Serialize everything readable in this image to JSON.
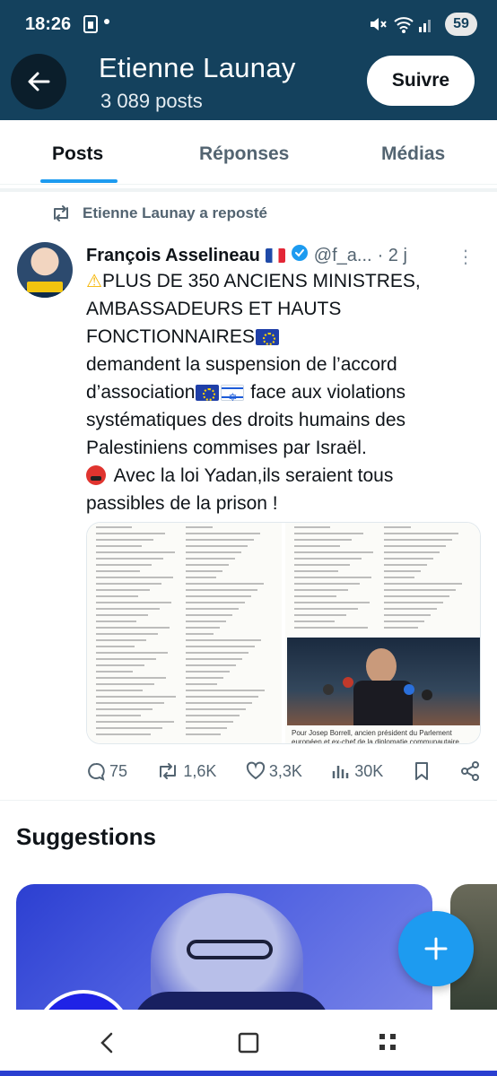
{
  "status_bar": {
    "time": "18:26",
    "battery": "59"
  },
  "header": {
    "title": "Etienne Launay",
    "subtitle": "3 089 posts",
    "follow_label": "Suivre"
  },
  "tabs": [
    {
      "label": "Posts",
      "active": true
    },
    {
      "label": "Réponses",
      "active": false
    },
    {
      "label": "Médias",
      "active": false
    }
  ],
  "tweet": {
    "repost_label": "Etienne Launay a reposté",
    "author_name": "François Asselineau",
    "author_handle": "@f_a...",
    "time_ago": "· 2 j",
    "text": {
      "line1": "PLUS DE 350 ANCIENS MINISTRES, AMBASSADEURS ET HAUTS FONCTIONNAIRES",
      "line2a": "demandent la suspension de l’accord d’association",
      "line2b": " face aux violations systématiques des droits humains des Palestiniens commises par Israël.",
      "line3": " Avec la loi Yadan,ils seraient tous passibles de la prison !"
    },
    "media_caption": "Pour Josep Borrell, ancien président du Parlement européen et ex-chef de la diplomatie communautaire (photo), «le gouvernement",
    "actions": {
      "replies": "75",
      "reposts": "1,6K",
      "likes": "3,3K",
      "views": "30K"
    }
  },
  "suggestions": {
    "title": "Suggestions"
  },
  "colors": {
    "header_bg": "#14415d",
    "accent": "#1d9bf0",
    "text_primary": "#0f1419",
    "text_secondary": "#536471"
  }
}
